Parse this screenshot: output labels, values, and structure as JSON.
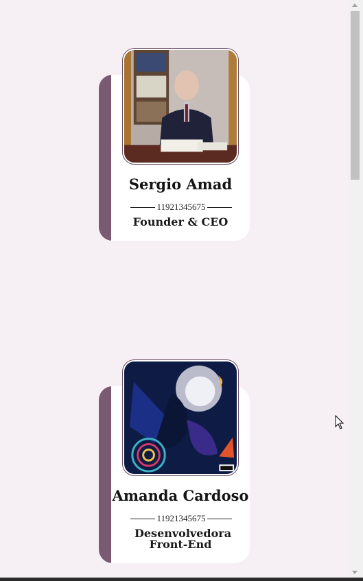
{
  "team": [
    {
      "name": "Sergio Amad",
      "phone": "11921345675",
      "role": "Founder & CEO",
      "photo_icon": "portrait-photo"
    },
    {
      "name": "Amanda Cardoso",
      "phone": "11921345675",
      "role": "Desenvolvedora Front-End",
      "photo_icon": "album-art-photo"
    }
  ],
  "colors": {
    "background": "#f6eff4",
    "accent": "#7a5a73",
    "card": "#ffffff"
  }
}
